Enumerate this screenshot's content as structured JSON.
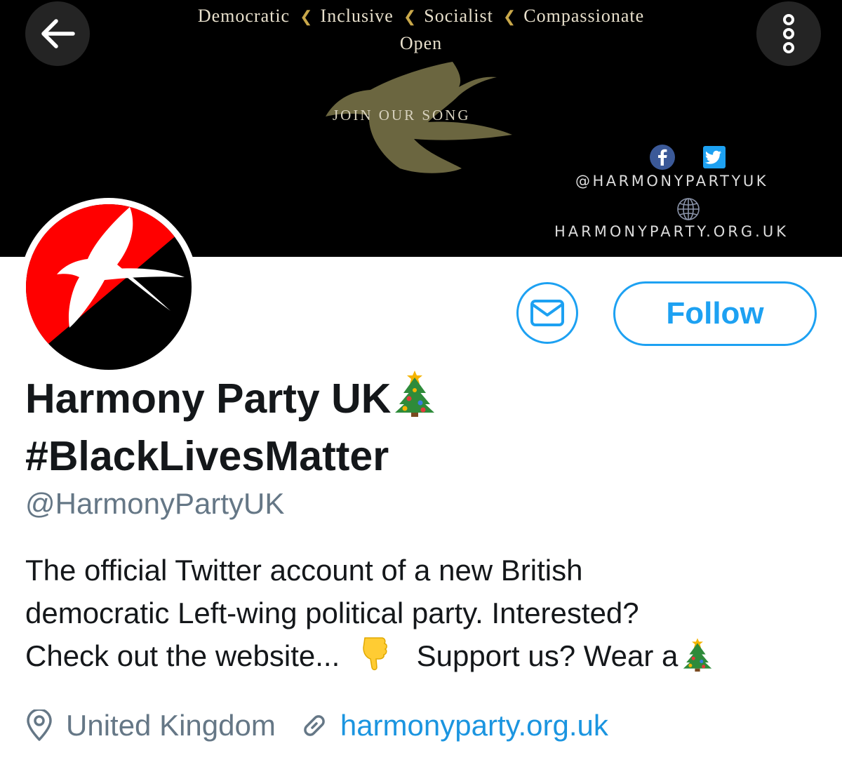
{
  "banner": {
    "values": [
      "Democratic",
      "Inclusive",
      "Socialist",
      "Compassionate"
    ],
    "values_last": "Open",
    "chevron": "❮",
    "tagline": "JOIN OUR SONG",
    "handle": "@HARMONYPARTYUK",
    "site": "HARMONYPARTY.ORG.UK",
    "social_icons": [
      "facebook-icon",
      "twitter-icon"
    ]
  },
  "nav": {
    "back_icon": "arrow-left-icon",
    "more_icon": "more-vertical-icon"
  },
  "actions": {
    "follow_label": "Follow",
    "message_icon": "mail-icon"
  },
  "profile": {
    "name_line1": "Harmony Party UK",
    "name_line2": "#BlackLivesMatter",
    "handle": "@HarmonyPartyUK",
    "bio_line1": "The official Twitter account of a new British",
    "bio_line2": "democratic Left-wing political party. Interested?",
    "bio_line3_a": "Check out the website...",
    "bio_line3_b": "Support us? Wear a",
    "location": "United Kingdom",
    "url": "harmonyparty.org.uk"
  },
  "colors": {
    "accent": "#1da1f2",
    "link": "#1b95e0",
    "muted": "#657786",
    "avatar_red": "#ff0000"
  }
}
